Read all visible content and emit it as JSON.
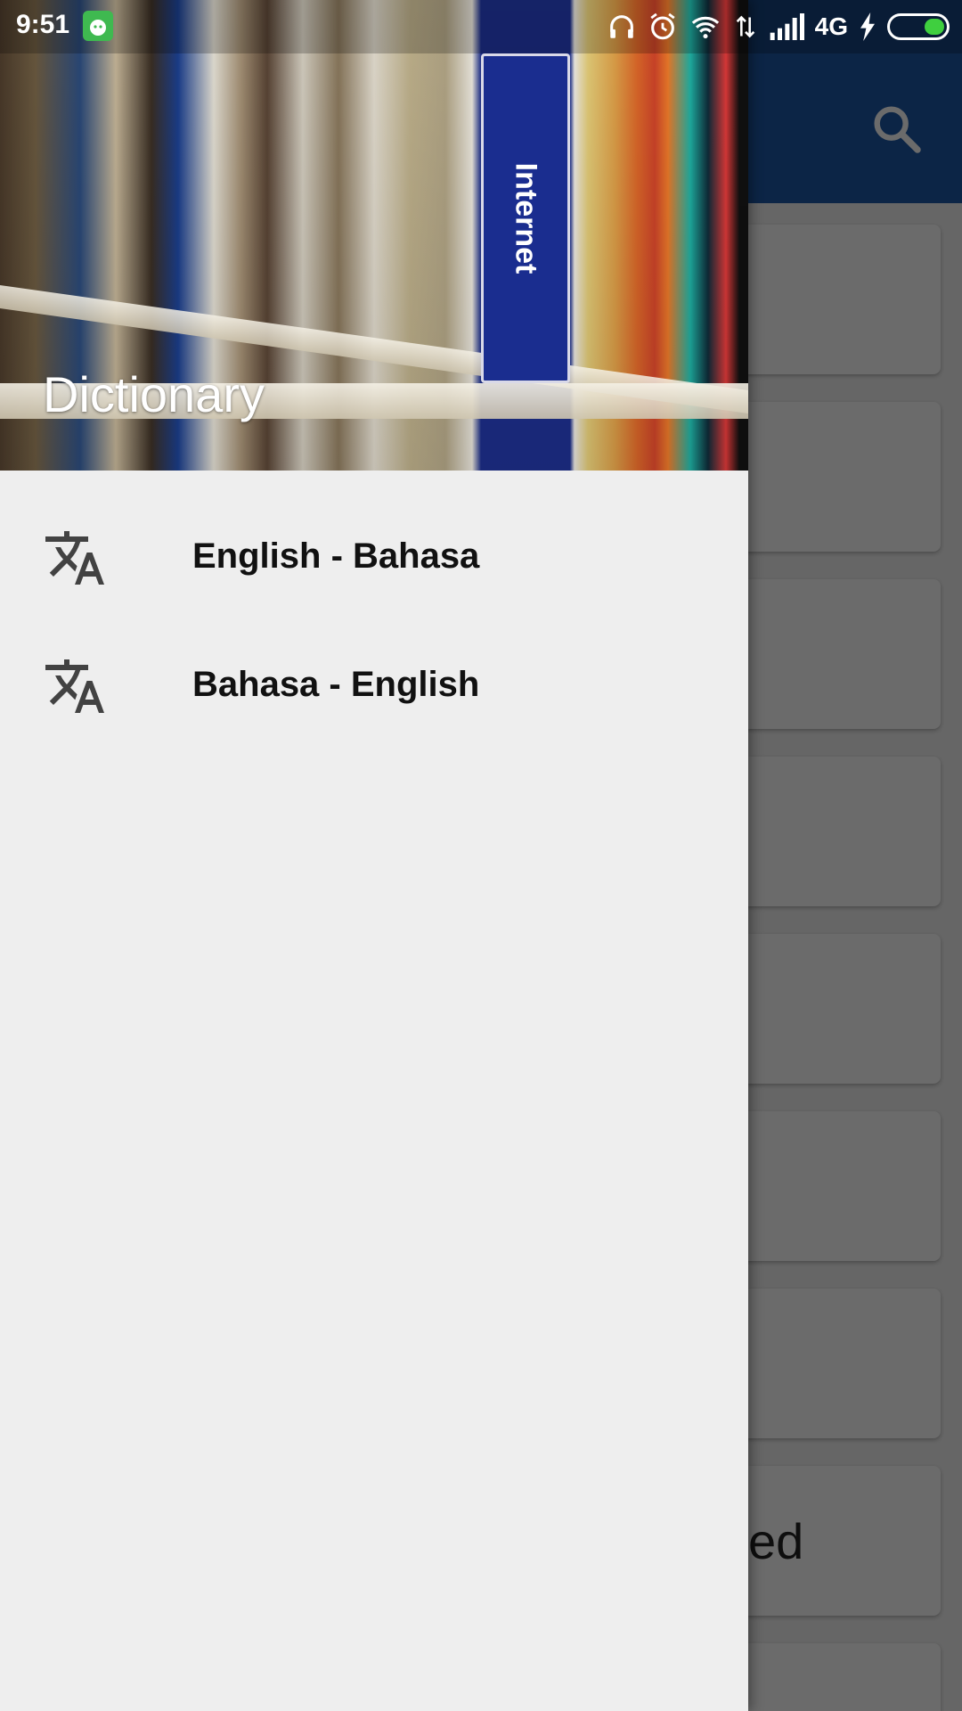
{
  "status_bar": {
    "time": "9:51",
    "network_type": "4G",
    "icons": [
      "app-notification-icon",
      "headphones-icon",
      "alarm-icon",
      "wifi-icon",
      "data-transfer-icon",
      "signal-icon",
      "charging-icon",
      "battery-icon"
    ]
  },
  "app_bar": {
    "search_icon": "search-icon",
    "color": "#1e5aa8"
  },
  "background_cards": [
    {
      "word": ""
    },
    {
      "word": ""
    },
    {
      "word": ""
    },
    {
      "word": ""
    },
    {
      "word": ""
    },
    {
      "word": ""
    },
    {
      "word": ""
    },
    {
      "word": "ed"
    }
  ],
  "drawer": {
    "header_title": "Dictionary",
    "header_book_label": "Internet",
    "items": [
      {
        "label": "English - Bahasa",
        "icon": "translate-icon"
      },
      {
        "label": "Bahasa - English",
        "icon": "translate-icon"
      }
    ]
  },
  "colors": {
    "drawer_bg": "#eeeeee",
    "battery_fill": "#3fcf3f",
    "app_badge": "#3fb950"
  }
}
